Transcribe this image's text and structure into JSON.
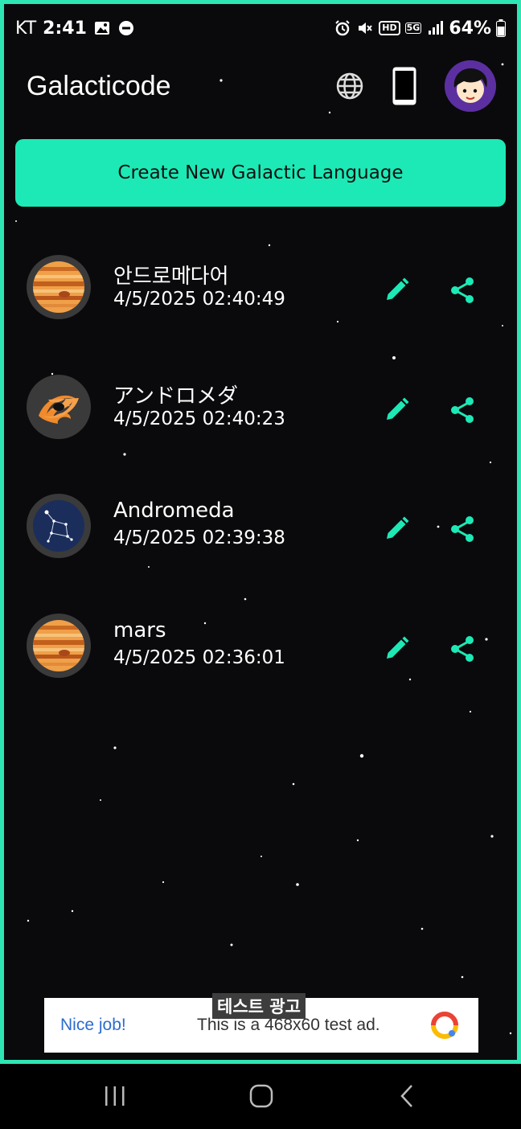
{
  "status_bar": {
    "carrier": "KT",
    "time": "2:41",
    "hd_label": "HD",
    "network_label": "5G",
    "battery": "64%"
  },
  "header": {
    "title": "Galacticode"
  },
  "create_button": {
    "label": "Create New Galactic Language"
  },
  "languages": [
    {
      "name": "안드로메다어",
      "datetime": "4/5/2025 02:40:49",
      "icon": "jupiter-planet-icon"
    },
    {
      "name": "アンドロメダ",
      "datetime": "4/5/2025 02:40:23",
      "icon": "galaxy-icon"
    },
    {
      "name": "Andromeda",
      "datetime": "4/5/2025 02:39:38",
      "icon": "constellation-icon"
    },
    {
      "name": "mars",
      "datetime": "4/5/2025 02:36:01",
      "icon": "jupiter-planet-icon"
    }
  ],
  "ad": {
    "tag": "테스트 광고",
    "headline": "Nice job!",
    "text": "This is a 468x60 test ad."
  },
  "colors": {
    "accent": "#1de9b6",
    "background": "#0a0a0c",
    "frame_border": "#2ee6b4"
  }
}
